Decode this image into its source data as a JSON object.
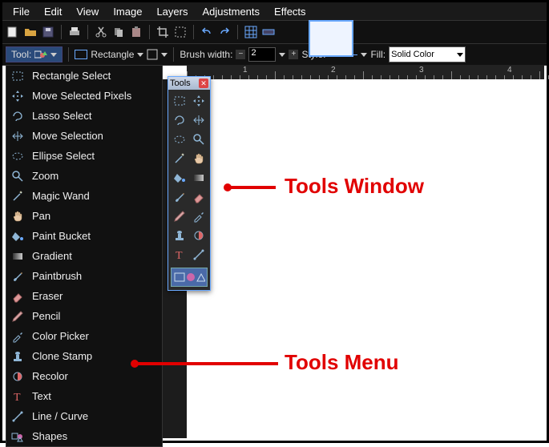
{
  "menubar": [
    "File",
    "Edit",
    "View",
    "Image",
    "Layers",
    "Adjustments",
    "Effects"
  ],
  "toolbar2": {
    "tool_label": "Tool:",
    "shape_label": "Rectangle",
    "brush_width_label": "Brush width:",
    "brush_width_value": "2",
    "style_label": "Style:",
    "fill_label": "Fill:",
    "fill_value": "Solid Color"
  },
  "tools_menu": {
    "items": [
      {
        "label": "Rectangle Select",
        "icon": "rect-select"
      },
      {
        "label": "Move Selected Pixels",
        "icon": "move-pixels"
      },
      {
        "label": "Lasso Select",
        "icon": "lasso"
      },
      {
        "label": "Move Selection",
        "icon": "move-sel"
      },
      {
        "label": "Ellipse Select",
        "icon": "ellipse-sel"
      },
      {
        "label": "Zoom",
        "icon": "zoom"
      },
      {
        "label": "Magic Wand",
        "icon": "wand"
      },
      {
        "label": "Pan",
        "icon": "pan"
      },
      {
        "label": "Paint Bucket",
        "icon": "bucket"
      },
      {
        "label": "Gradient",
        "icon": "gradient"
      },
      {
        "label": "Paintbrush",
        "icon": "brush"
      },
      {
        "label": "Eraser",
        "icon": "eraser"
      },
      {
        "label": "Pencil",
        "icon": "pencil"
      },
      {
        "label": "Color Picker",
        "icon": "picker"
      },
      {
        "label": "Clone Stamp",
        "icon": "stamp"
      },
      {
        "label": "Recolor",
        "icon": "recolor"
      },
      {
        "label": "Text",
        "icon": "text"
      },
      {
        "label": "Line / Curve",
        "icon": "line"
      },
      {
        "label": "Shapes",
        "icon": "shapes"
      }
    ]
  },
  "tools_window": {
    "title": "Tools",
    "cells": [
      "rect-select",
      "move-pixels",
      "lasso",
      "move-sel",
      "ellipse-sel",
      "zoom",
      "wand",
      "pan",
      "bucket",
      "gradient",
      "brush",
      "eraser",
      "pencil",
      "picker",
      "stamp",
      "recolor",
      "text",
      "line"
    ]
  },
  "ruler": {
    "labels": [
      "1",
      "2",
      "3",
      "4"
    ]
  },
  "annotations": {
    "tools_window": "Tools Window",
    "tools_menu": "Tools Menu"
  }
}
